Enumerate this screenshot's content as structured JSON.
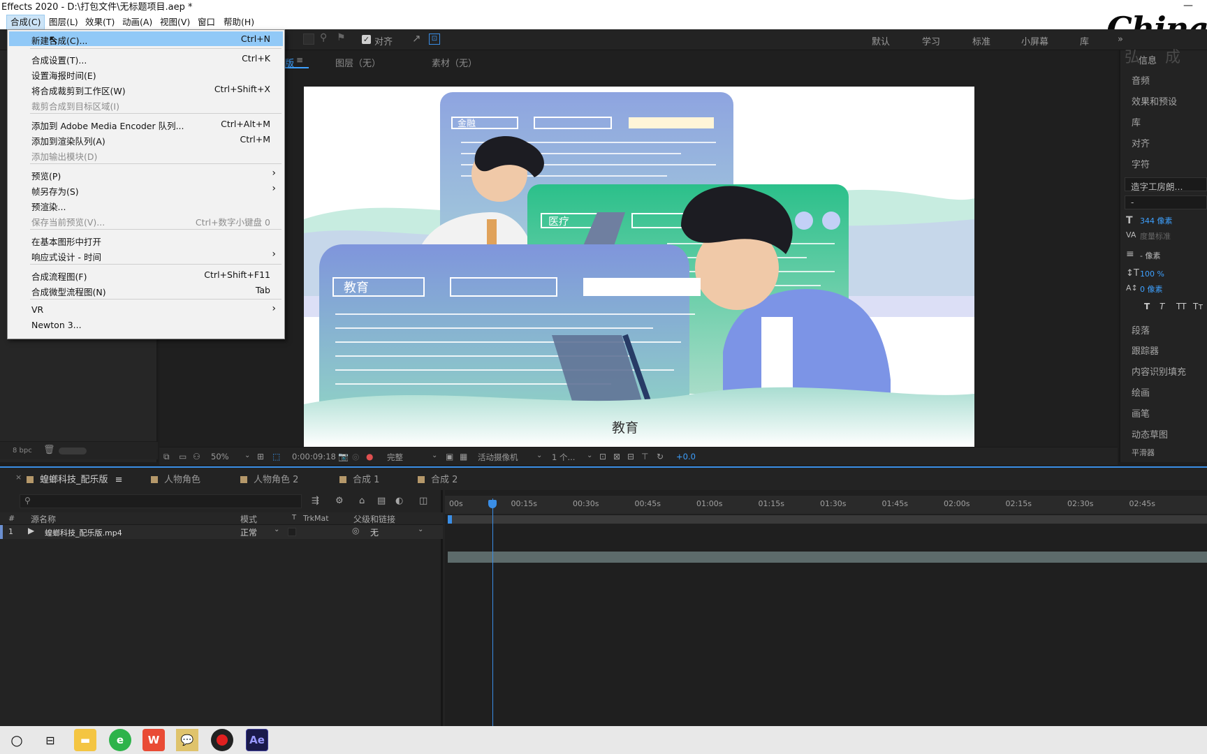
{
  "title": {
    "text": "Effects 2020 - D:\\打包文件\\无标题项目.aep *",
    "min": "—"
  },
  "menubar": [
    {
      "label": "合成(C)",
      "active": true
    },
    {
      "label": "图层(L)"
    },
    {
      "label": "效果(T)"
    },
    {
      "label": "动画(A)"
    },
    {
      "label": "视图(V)"
    },
    {
      "label": "窗口"
    },
    {
      "label": "帮助(H)"
    }
  ],
  "logo": {
    "text": "China"
  },
  "toolbar": {
    "align_label": "对齐",
    "workspaces": [
      "默认",
      "学习",
      "标准",
      "小屏幕",
      "库"
    ],
    "more": "»"
  },
  "comp_menu": {
    "items": [
      {
        "label": "新建合成(C)...",
        "shortcut": "Ctrl+N"
      },
      {
        "label": "合成设置(T)...",
        "shortcut": "Ctrl+K"
      },
      {
        "label": "设置海报时间(E)",
        "shortcut": ""
      },
      {
        "label": "将合成裁剪到工作区(W)",
        "shortcut": "Ctrl+Shift+X"
      },
      {
        "label": "裁剪合成到目标区域(I)",
        "shortcut": ""
      },
      {
        "label": "添加到 Adobe Media Encoder 队列...",
        "shortcut": "Ctrl+Alt+M"
      },
      {
        "label": "添加到渲染队列(A)",
        "shortcut": "Ctrl+M"
      },
      {
        "label": "添加输出模块(D)",
        "shortcut": ""
      },
      {
        "label": "预览(P)",
        "shortcut": ""
      },
      {
        "label": "帧另存为(S)",
        "shortcut": ""
      },
      {
        "label": "预渲染...",
        "shortcut": ""
      },
      {
        "label": "保存当前预览(V)...",
        "shortcut": "Ctrl+数字小键盘 0"
      },
      {
        "label": "在基本图形中打开",
        "shortcut": ""
      },
      {
        "label": "响应式设计 - 时间",
        "shortcut": ""
      },
      {
        "label": "合成流程图(F)",
        "shortcut": "Ctrl+Shift+F11"
      },
      {
        "label": "合成微型流程图(N)",
        "shortcut": "Tab"
      },
      {
        "label": "VR",
        "shortcut": ""
      },
      {
        "label": "Newton 3...",
        "shortcut": ""
      }
    ]
  },
  "viewer": {
    "tab_fragment": "版",
    "layer_tab": "图层（无）",
    "footage_tab": "素材（无）",
    "art": {
      "finance": "金融",
      "medical": "医疗",
      "education": "教育",
      "caption": "教育"
    }
  },
  "viewer_footer": {
    "zoom": "50%",
    "timecode": "0:00:09:18",
    "resolution": "完整",
    "camera": "活动摄像机",
    "views": "1 个...",
    "exposure": "+0.0"
  },
  "left_panel": {
    "bpc": "8 bpc"
  },
  "right_panel": {
    "top_labels": [
      "弘",
      "成"
    ],
    "items": [
      "信息",
      "音频",
      "效果和预设",
      "库",
      "对齐",
      "字符"
    ],
    "font_name": "造字工房朗...",
    "font_style": "-",
    "font_size": "344 像素",
    "kerning": "度量标准",
    "leading": "- 像素",
    "vscale": "100 %",
    "baseline": "0 像素",
    "typo_buttons": [
      "T",
      "T",
      "TT",
      "Tт"
    ],
    "items2": [
      "段落",
      "跟踪器",
      "内容识别填充",
      "绘画",
      "画笔",
      "动态草图",
      "平滑器"
    ]
  },
  "timeline": {
    "tabs": [
      "蝗螂科技_配乐版",
      "人物角色",
      "人物角色 2",
      "合成 1",
      "合成 2"
    ],
    "search_placeholder": "",
    "columns": {
      "num": "#",
      "source": "源名称",
      "mode": "模式",
      "t": "T",
      "trkmat": "TrkMat",
      "parent": "父级和链接"
    },
    "layers": [
      {
        "num": "1",
        "name": "蝗螂科技_配乐版.mp4",
        "mode": "正常",
        "parent": "无"
      }
    ],
    "ruler": [
      "00s",
      "00:15s",
      "00:30s",
      "00:45s",
      "01:00s",
      "01:15s",
      "01:30s",
      "01:45s",
      "02:00s",
      "02:15s",
      "02:30s",
      "02:45s"
    ]
  },
  "taskbar": {
    "ae_label": "Ae",
    "wps_label": "W"
  }
}
